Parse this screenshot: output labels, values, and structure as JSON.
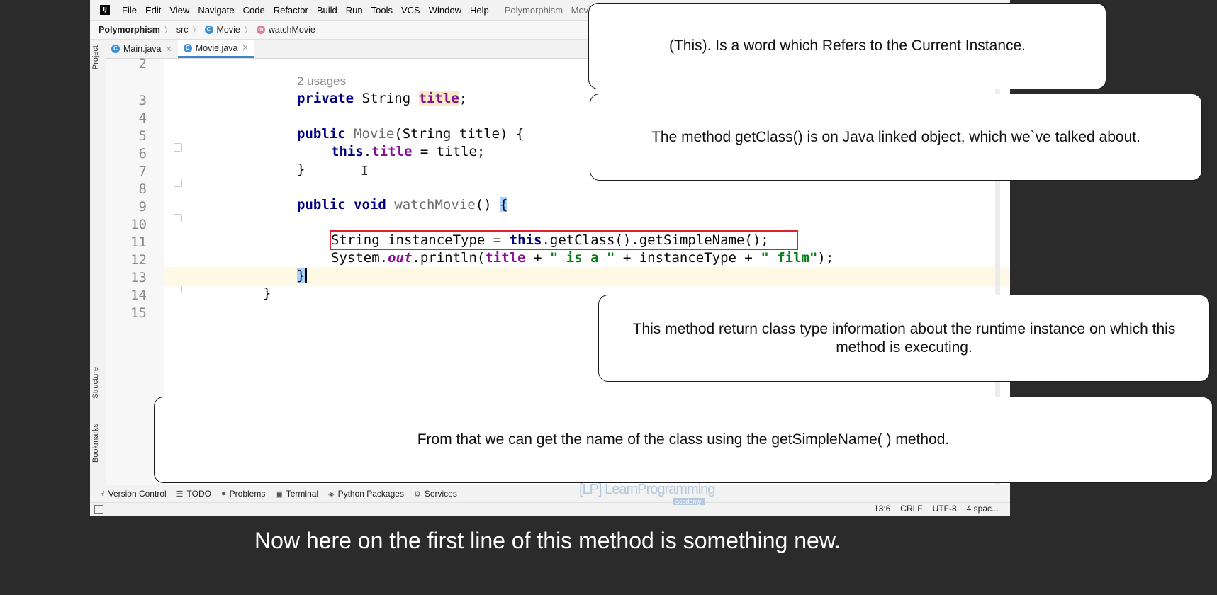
{
  "menu": [
    "File",
    "Edit",
    "View",
    "Navigate",
    "Code",
    "Refactor",
    "Build",
    "Run",
    "Tools",
    "VCS",
    "Window",
    "Help"
  ],
  "window_title": "Polymorphism - Movie.ja",
  "breadcrumb": [
    "Polymorphism",
    "src",
    "Movie",
    "watchMovie"
  ],
  "left_tools": [
    "Project",
    "Structure",
    "Bookmarks"
  ],
  "tabs": [
    "Main.java",
    "Movie.java"
  ],
  "active_tab": "Movie.java",
  "line_numbers": [
    "2",
    "3",
    "4",
    "5",
    "6",
    "7",
    "8",
    "9",
    "10",
    "11",
    "12",
    "13",
    "14",
    "15"
  ],
  "usages_hint": "2 usages",
  "code": {
    "l3": {
      "kw": "private",
      "type": " String ",
      "field": "title",
      "end": ";"
    },
    "l5": {
      "kw": "public",
      "name": " Movie",
      "rest": "(String title) {"
    },
    "l6": {
      "kw": "this",
      "dot": ".",
      "field": "title",
      "rest": " = title;"
    },
    "l7": "}",
    "l9": {
      "kw": "public void",
      "name": " watchMovie",
      "rest": "() ",
      "brace": "{"
    },
    "l11": {
      "a": "String instanceType = ",
      "kw": "this",
      "b": ".getClass().getSimpleName();"
    },
    "l12": {
      "a": "System.",
      "stat": "out",
      "b": ".println(",
      "field": "title",
      "c": " + ",
      "s1": "\" is a \"",
      "d": " + instanceType + ",
      "s2": "\" film\"",
      "e": ");"
    },
    "l13": "}",
    "l14": "}"
  },
  "bottom_tools": [
    "Version Control",
    "TODO",
    "Problems",
    "Terminal",
    "Python Packages",
    "Services"
  ],
  "status": {
    "position": "13:6",
    "line_sep": "CRLF",
    "encoding": "UTF-8",
    "indent": "4 spac..."
  },
  "watermark": {
    "main": "LearnProgramming",
    "sub": "academy"
  },
  "callouts": [
    "(This). Is a word which Refers to the Current Instance.",
    "The method getClass() is on Java linked object, which we`ve talked about.",
    "This method return class type information about the runtime instance on which this method is executing.",
    "From that we can get the name of the class using the getSimpleName( ) method."
  ],
  "subtitle": "Now here on the first line of this method is something new."
}
